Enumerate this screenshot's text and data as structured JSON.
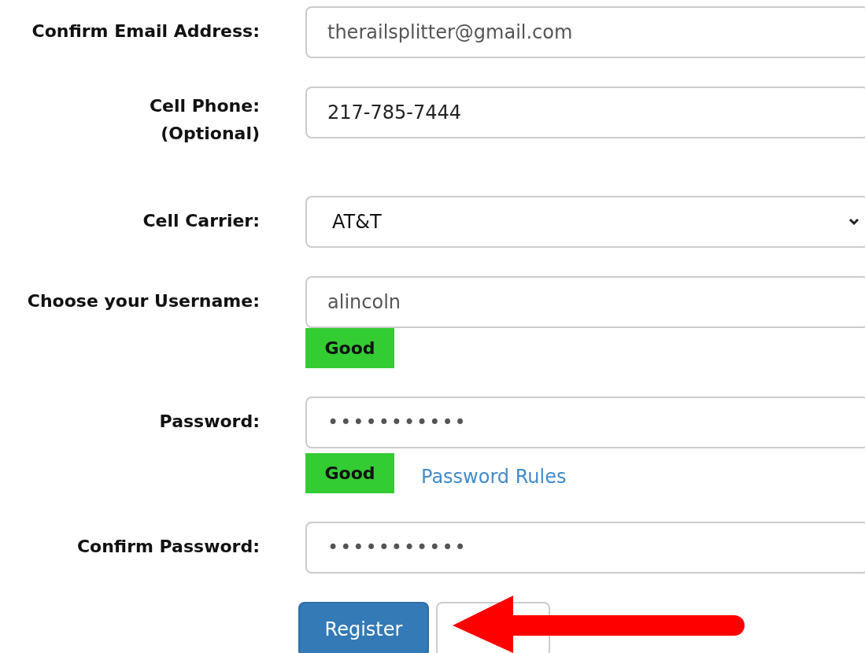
{
  "fields": [
    {
      "label": "Confirm Email Address:",
      "kind": "text",
      "value": "therailsplitter@gmail.com",
      "muted": true
    },
    {
      "label": "Cell Phone:",
      "note": "(Optional)",
      "kind": "text",
      "value": "217-785-7444",
      "muted": false
    },
    {
      "label": "Cell Carrier:",
      "kind": "select",
      "value": "AT&T"
    },
    {
      "label": "Choose your Username:",
      "kind": "text",
      "value": "alincoln",
      "muted": true,
      "badge": "Good"
    },
    {
      "label": "Password:",
      "kind": "text",
      "value": "•••••••••••",
      "muted": true,
      "badge": "Good",
      "link": "Password Rules"
    },
    {
      "label": "Confirm Password:",
      "kind": "text",
      "value": "•••••••••••",
      "muted": true
    }
  ],
  "buttons": [
    {
      "label": "Register",
      "kind": "primary"
    },
    {
      "kind": "secondary"
    }
  ],
  "annotation": {
    "kind": "arrow"
  }
}
